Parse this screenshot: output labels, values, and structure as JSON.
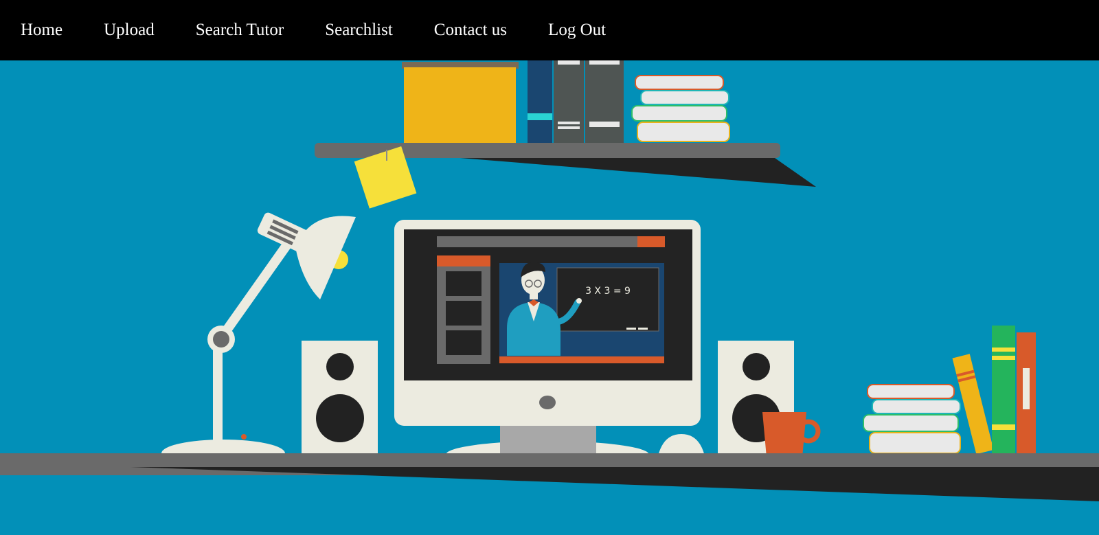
{
  "nav": {
    "items": [
      {
        "label": "Home"
      },
      {
        "label": "Upload"
      },
      {
        "label": "Search Tutor"
      },
      {
        "label": "Searchlist"
      },
      {
        "label": "Contact us"
      },
      {
        "label": "Log Out"
      }
    ]
  },
  "hero": {
    "chalkboard_text": "3 X 3 = 9"
  },
  "colors": {
    "navbar_bg": "#000000",
    "nav_text": "#ffffff",
    "hero_bg": "#0290b8"
  }
}
